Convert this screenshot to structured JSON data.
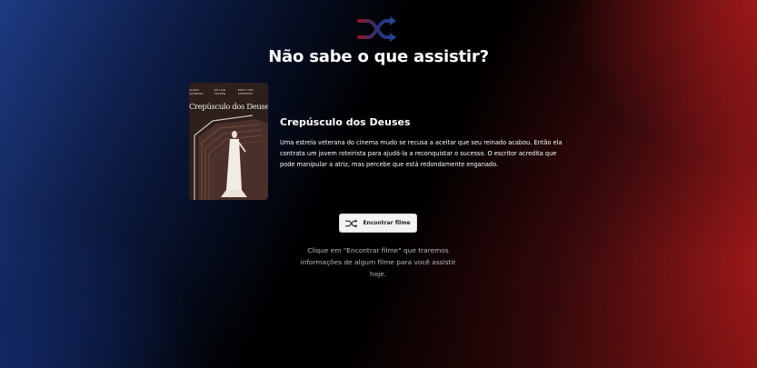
{
  "header": {
    "logo_icon": "shuffle-icon",
    "title": "Não sabe o que assistir?"
  },
  "movie": {
    "poster": {
      "credits": [
        "GLORIA SWANSON",
        "WILLIAM HOLDEN",
        "ERICH VON STROHEIM"
      ],
      "title_text": "Crepúsculo dos Deuses"
    },
    "title": "Crepúsculo dos Deuses",
    "description": "Uma estrela veterana do cinema mudo se recusa a aceitar que seu reinado acabou. Então ela contrata um jovem roteirista para ajudá-la a reconquistar o sucesso. O escritor acredita que pode manipular a atriz, mas percebe que está redondamente enganado."
  },
  "action": {
    "button_icon": "shuffle-icon",
    "button_label": "Encontrar filme"
  },
  "hint": {
    "text": "Clique em \"Encontrar filme\" que traremos informações de algum filme para você assistir hoje."
  },
  "colors": {
    "accent_red": "#b81c1c",
    "accent_blue": "#1d3a82",
    "button_bg": "#f3f3f3"
  }
}
